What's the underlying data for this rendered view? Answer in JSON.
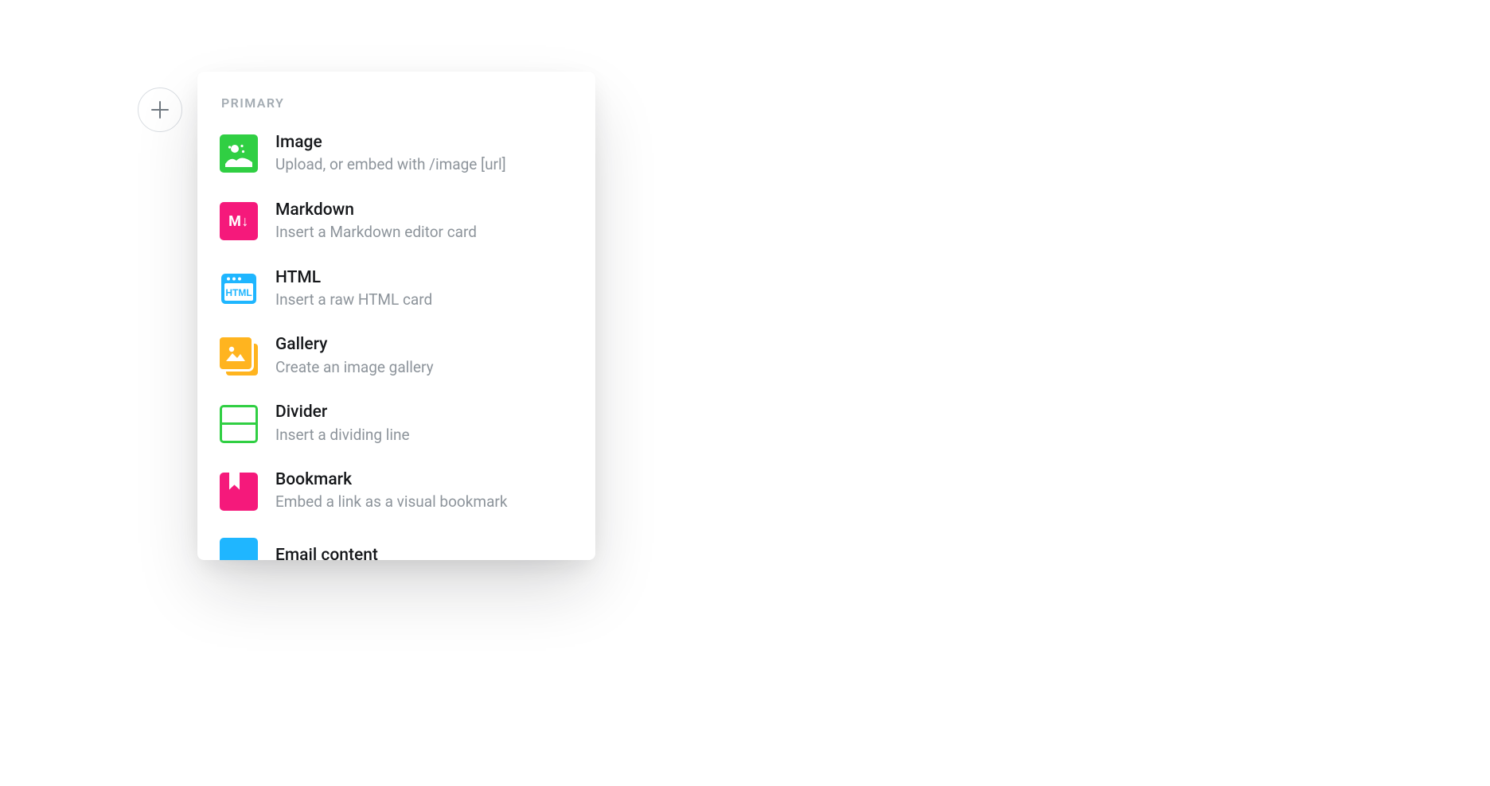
{
  "section_label": "PRIMARY",
  "items": [
    {
      "title": "Image",
      "desc": "Upload, or embed with /image [url]"
    },
    {
      "title": "Markdown",
      "desc": "Insert a Markdown editor card"
    },
    {
      "title": "HTML",
      "desc": "Insert a raw HTML card"
    },
    {
      "title": "Gallery",
      "desc": "Create an image gallery"
    },
    {
      "title": "Divider",
      "desc": "Insert a dividing line"
    },
    {
      "title": "Bookmark",
      "desc": "Embed a link as a visual bookmark"
    },
    {
      "title": "Email content",
      "desc": ""
    }
  ],
  "md_label": "M↓"
}
